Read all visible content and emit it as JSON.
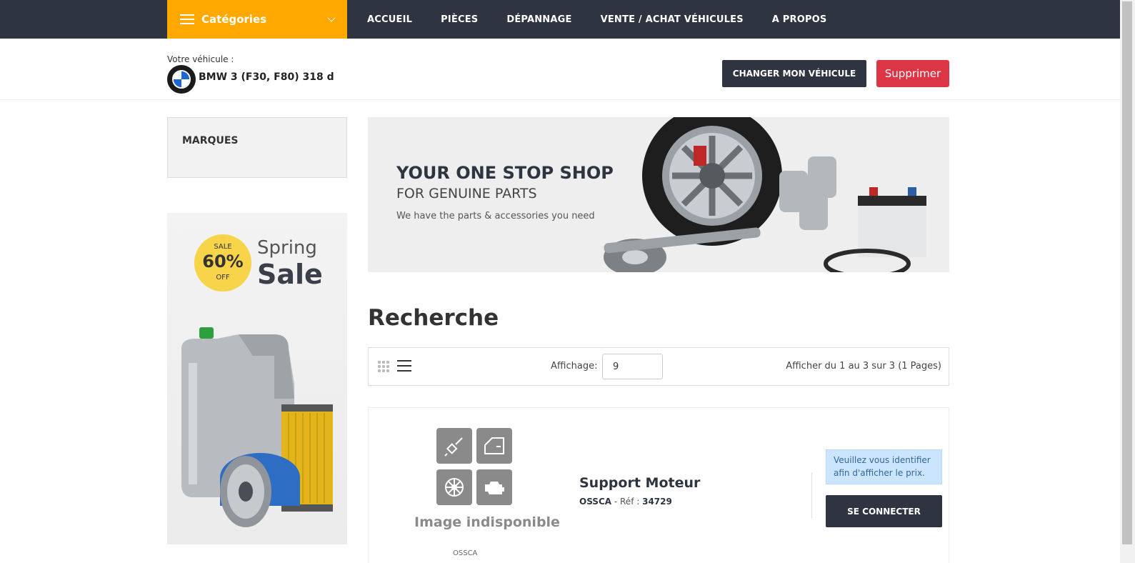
{
  "topnav": {
    "categories_label": "Catégories",
    "items": [
      {
        "label": "ACCUEIL"
      },
      {
        "label": "PIÈCES"
      },
      {
        "label": "DÉPANNAGE"
      },
      {
        "label": "VENTE / ACHAT VÉHICULES"
      },
      {
        "label": "A PROPOS"
      }
    ]
  },
  "vehicle": {
    "label": "Votre véhicule :",
    "name": "BMW 3 (F30, F80) 318 d",
    "change_button": "CHANGER MON VÉHICULE",
    "delete_button": "Supprimer"
  },
  "sidebar": {
    "marques_title": "MARQUES",
    "promo": {
      "badge_top": "SALE",
      "badge_percent": "60%",
      "badge_bottom": "OFF",
      "line1": "Spring",
      "line2": "Sale"
    }
  },
  "hero": {
    "title": "YOUR ONE STOP SHOP",
    "subtitle": "FOR GENUINE PARTS",
    "tagline": "We have the parts & accessories you need"
  },
  "search": {
    "heading": "Recherche",
    "display_label": "Affichage:",
    "display_value": "9",
    "results_count": "Afficher du 1 au 3 sur 3 (1 Pages)"
  },
  "products": [
    {
      "image_placeholder": "Image indisponible",
      "broken_alt": "OSSCA",
      "name": "Support Moteur",
      "brand": "OSSCA",
      "ref_sep": " - Réf : ",
      "ref": "34729",
      "price_note": "Veuillez vous identifier afin d'afficher le prix.",
      "login_button": "SE CONNECTER"
    }
  ],
  "colors": {
    "nav_bg": "#2f3441",
    "accent": "#ffa800",
    "danger": "#dc3545",
    "info_bg": "#cce5ff"
  }
}
